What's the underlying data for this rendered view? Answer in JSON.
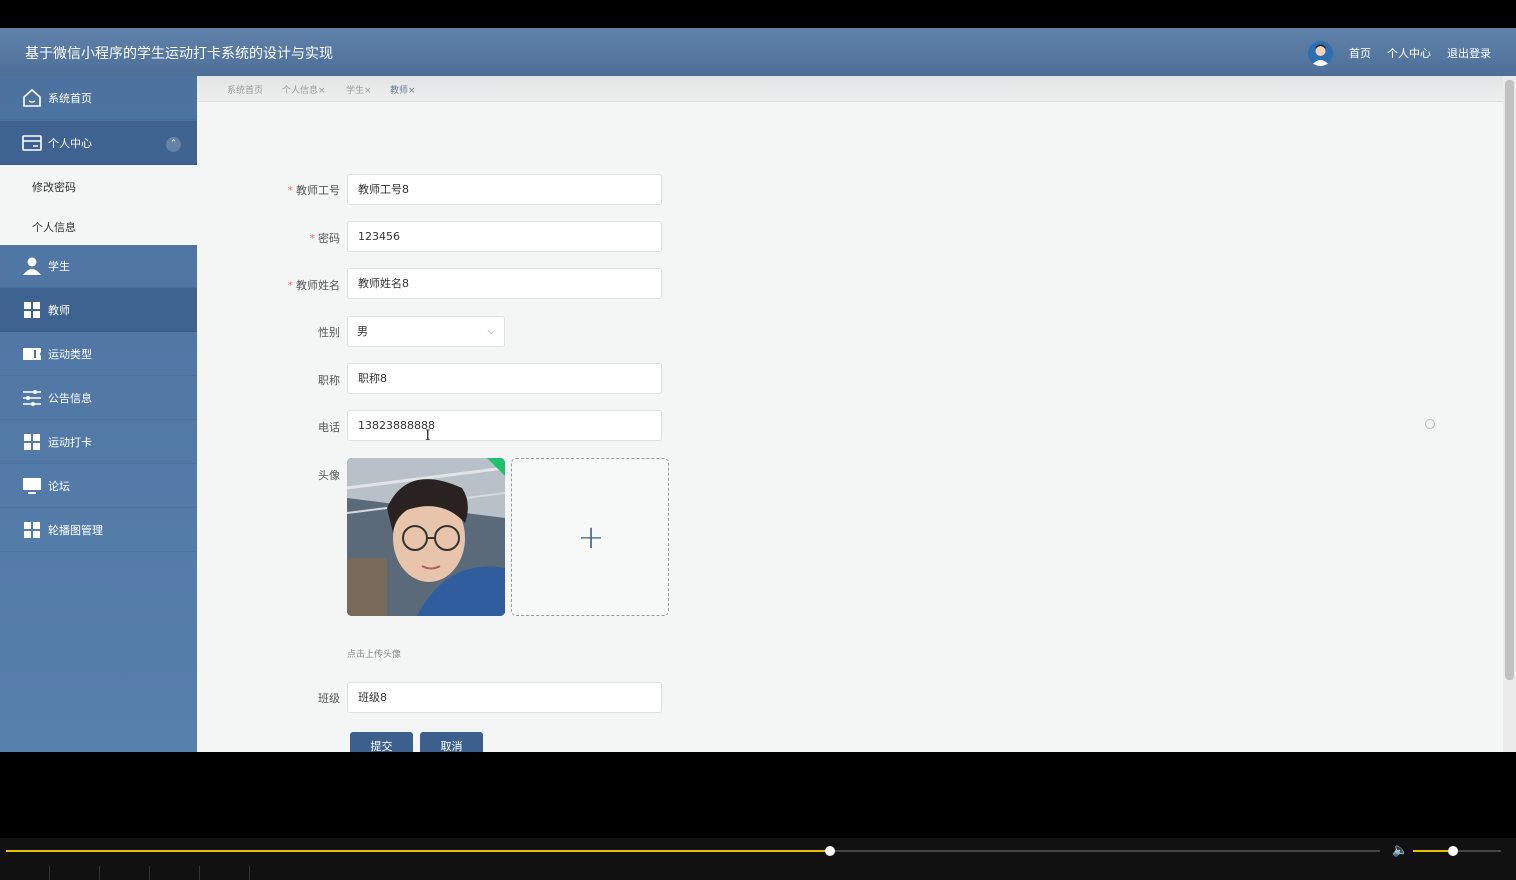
{
  "header": {
    "title": "基于微信小程序的学生运动打卡系统的设计与实现",
    "links": [
      "首页",
      "个人中心",
      "退出登录"
    ]
  },
  "sidebar": {
    "items": [
      {
        "label": "系统首页",
        "icon": "home-icon"
      },
      {
        "label": "个人中心",
        "icon": "card-icon"
      },
      {
        "label": "学生",
        "icon": "user-icon"
      },
      {
        "label": "教师",
        "icon": "grid-icon"
      },
      {
        "label": "运动类型",
        "icon": "ticket-icon"
      },
      {
        "label": "公告信息",
        "icon": "sliders-icon"
      },
      {
        "label": "运动打卡",
        "icon": "grid-icon"
      },
      {
        "label": "论坛",
        "icon": "monitor-icon"
      },
      {
        "label": "轮播图管理",
        "icon": "grid-icon"
      }
    ],
    "submenu": [
      "修改密码",
      "个人信息"
    ]
  },
  "tabs": [
    "系统首页",
    "个人信息×",
    "学生×",
    "教师×"
  ],
  "form": {
    "teacher_id": {
      "label": "教师工号",
      "value": "教师工号8"
    },
    "password": {
      "label": "密码",
      "value": "123456"
    },
    "teacher_name": {
      "label": "教师姓名",
      "value": "教师姓名8"
    },
    "gender": {
      "label": "性别",
      "value": "男"
    },
    "title": {
      "label": "职称",
      "value": "职称8"
    },
    "phone": {
      "label": "电话",
      "value": "13823888888"
    },
    "avatar": {
      "label": "头像",
      "tip": "点击上传头像"
    },
    "class": {
      "label": "班级",
      "value": "班级8"
    },
    "submit_label": "提交",
    "cancel_label": "取消"
  },
  "player": {
    "progress": 0.6,
    "volume": 0.45
  },
  "colors": {
    "header": "#5a7ca6",
    "sidebar": "#4c72a0",
    "sidebar_active": "#3e6391",
    "button": "#3c5f8e",
    "required": "#f56c6c",
    "progress": "#e6c300"
  }
}
